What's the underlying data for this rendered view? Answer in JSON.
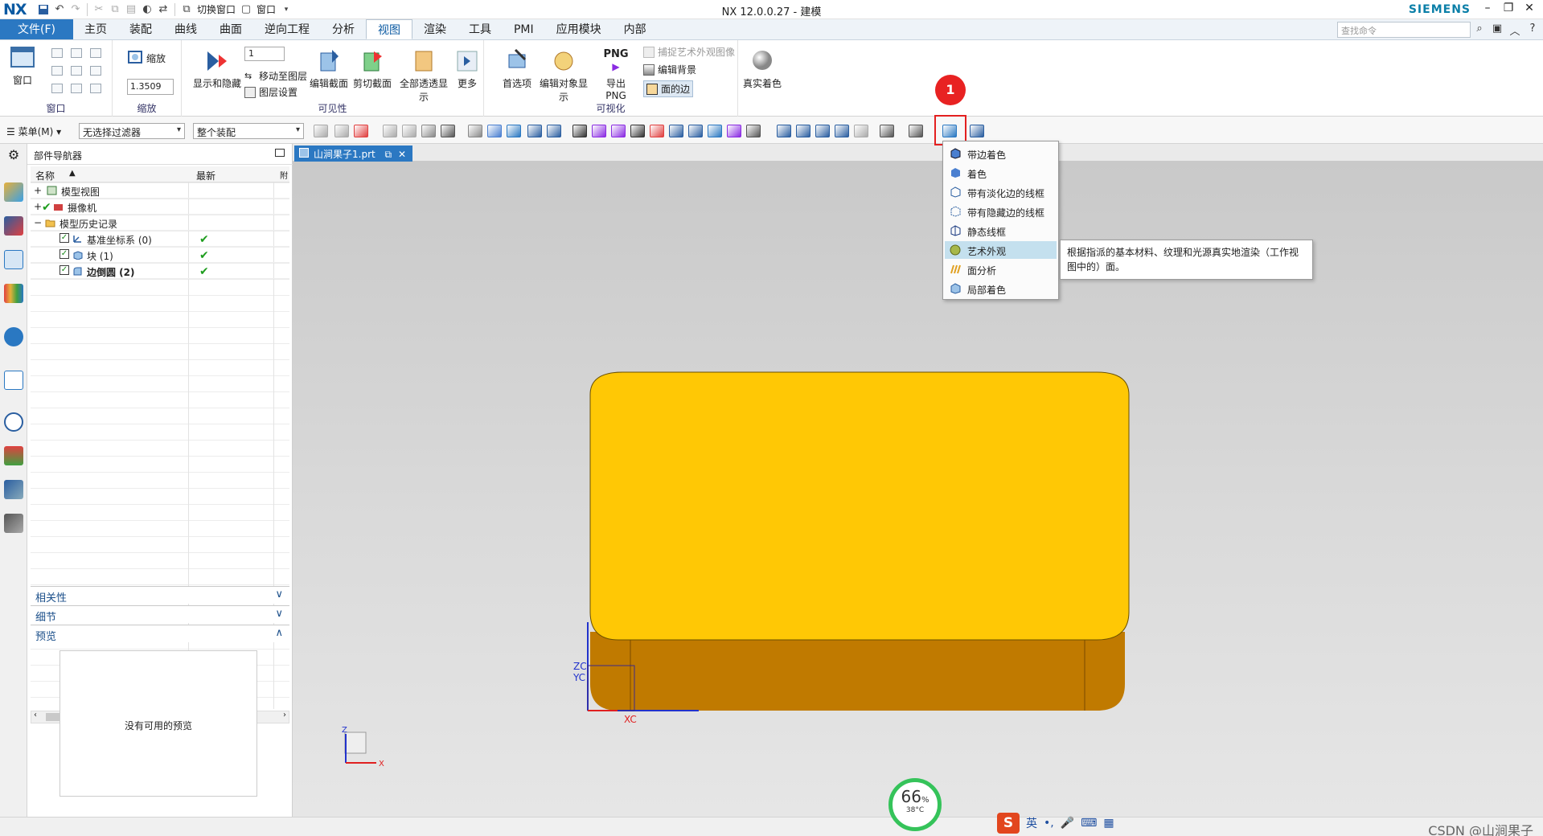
{
  "app": {
    "logo": "NX",
    "title": "NX 12.0.0.27 - 建模",
    "brand": "SIEMENS",
    "quick_access": {
      "switch_window": "切换窗口",
      "window": "窗口"
    }
  },
  "menu_tabs": [
    "文件(F)",
    "主页",
    "装配",
    "曲线",
    "曲面",
    "逆向工程",
    "分析",
    "视图",
    "渲染",
    "工具",
    "PMI",
    "应用模块",
    "内部"
  ],
  "active_tab": "视图",
  "search": {
    "placeholder": "查找命令"
  },
  "ribbon": {
    "window_group": {
      "label": "窗口",
      "button": "窗口"
    },
    "zoom_group": {
      "label": "缩放",
      "button": "缩放",
      "scale_value": "1.3509"
    },
    "visibility_group": {
      "label": "可见性",
      "layer_value": "1",
      "show_hide": "显示和隐藏",
      "move_to_layer": "移动至图层",
      "layer_settings": "图层设置",
      "edit_section": "编辑截面",
      "clip_section": "剪切截面",
      "all_through": "全部透透显示",
      "more": "更多"
    },
    "visualization_group": {
      "label": "可视化",
      "preferences": "首选项",
      "edit_object_display": "编辑对象显示",
      "export_png_top": "PNG",
      "export_png": "导出 PNG",
      "capture_art": "捕捉艺术外观图像",
      "edit_background": "编辑背景",
      "face_edges": "面的边",
      "true_shading": "真实着色"
    }
  },
  "toolbar": {
    "menu": "菜单(M)",
    "filter": "无选择过滤器",
    "assembly": "整个装配"
  },
  "navigator": {
    "title": "部件导航器",
    "columns": {
      "name": "名称",
      "latest": "最新",
      "extra": "附"
    },
    "rows": [
      {
        "label": "模型视图",
        "latest": ""
      },
      {
        "label": "摄像机",
        "latest": ""
      },
      {
        "label": "模型历史记录",
        "latest": ""
      },
      {
        "label": "基准坐标系 (0)",
        "latest": "✔"
      },
      {
        "label": "块 (1)",
        "latest": "✔"
      },
      {
        "label": "边倒圆 (2)",
        "latest": "✔"
      }
    ],
    "sections": {
      "dependency": "相关性",
      "details": "细节",
      "preview": "预览"
    },
    "preview_empty": "没有可用的预览"
  },
  "document": {
    "tab_label": "山涧果子1.prt"
  },
  "render_menu": {
    "items": [
      "带边着色",
      "着色",
      "带有淡化边的线框",
      "带有隐藏边的线框",
      "静态线框",
      "艺术外观",
      "面分析",
      "局部着色"
    ],
    "highlighted_index": 5,
    "tooltip": "根据指派的基本材料、纹理和光源真实地渲染（工作视图中的）面。"
  },
  "callout": {
    "number": "1"
  },
  "axes": {
    "zc": "ZC",
    "yc": "YC",
    "xc": "XC",
    "mini_z": "Z",
    "mini_x": "X"
  },
  "status": {
    "perf_value": "66",
    "perf_unit": "%",
    "perf_temp": "38°C",
    "ime_lang": "英",
    "watermark": "CSDN @山涧果子"
  },
  "colors": {
    "accent": "#2b78c2",
    "model_top": "#ffc805",
    "model_side": "#c07a00",
    "callout": "#e32020"
  }
}
